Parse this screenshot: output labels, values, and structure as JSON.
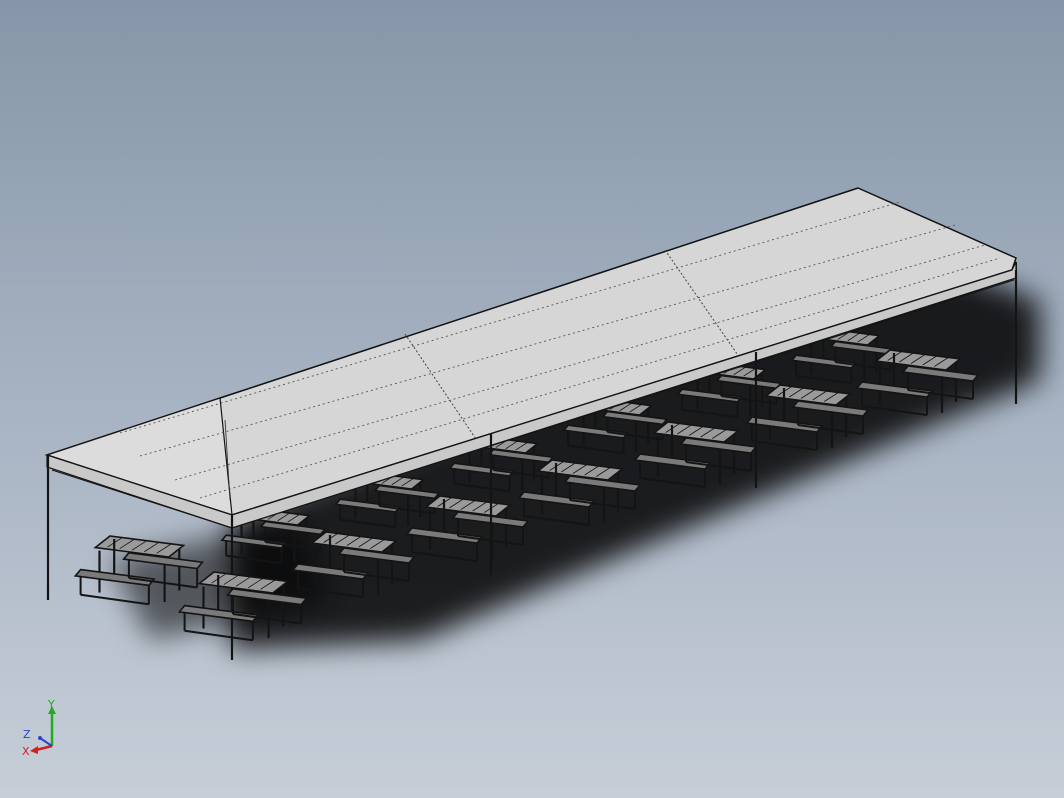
{
  "viewport": {
    "background_top": "#8696a8",
    "background_bottom": "#c7ced8",
    "roof_color": "#d6d6d6",
    "line_color": "#141414",
    "shadow_color": "#0a0a0a"
  },
  "model": {
    "tent_bays": 3,
    "table_groups": 14
  },
  "triad": {
    "y_label": "Y",
    "z_label": "Z",
    "x_label": "X",
    "y_color": "#22aa22",
    "z_color": "#2a44cc",
    "x_color": "#cc2222"
  }
}
